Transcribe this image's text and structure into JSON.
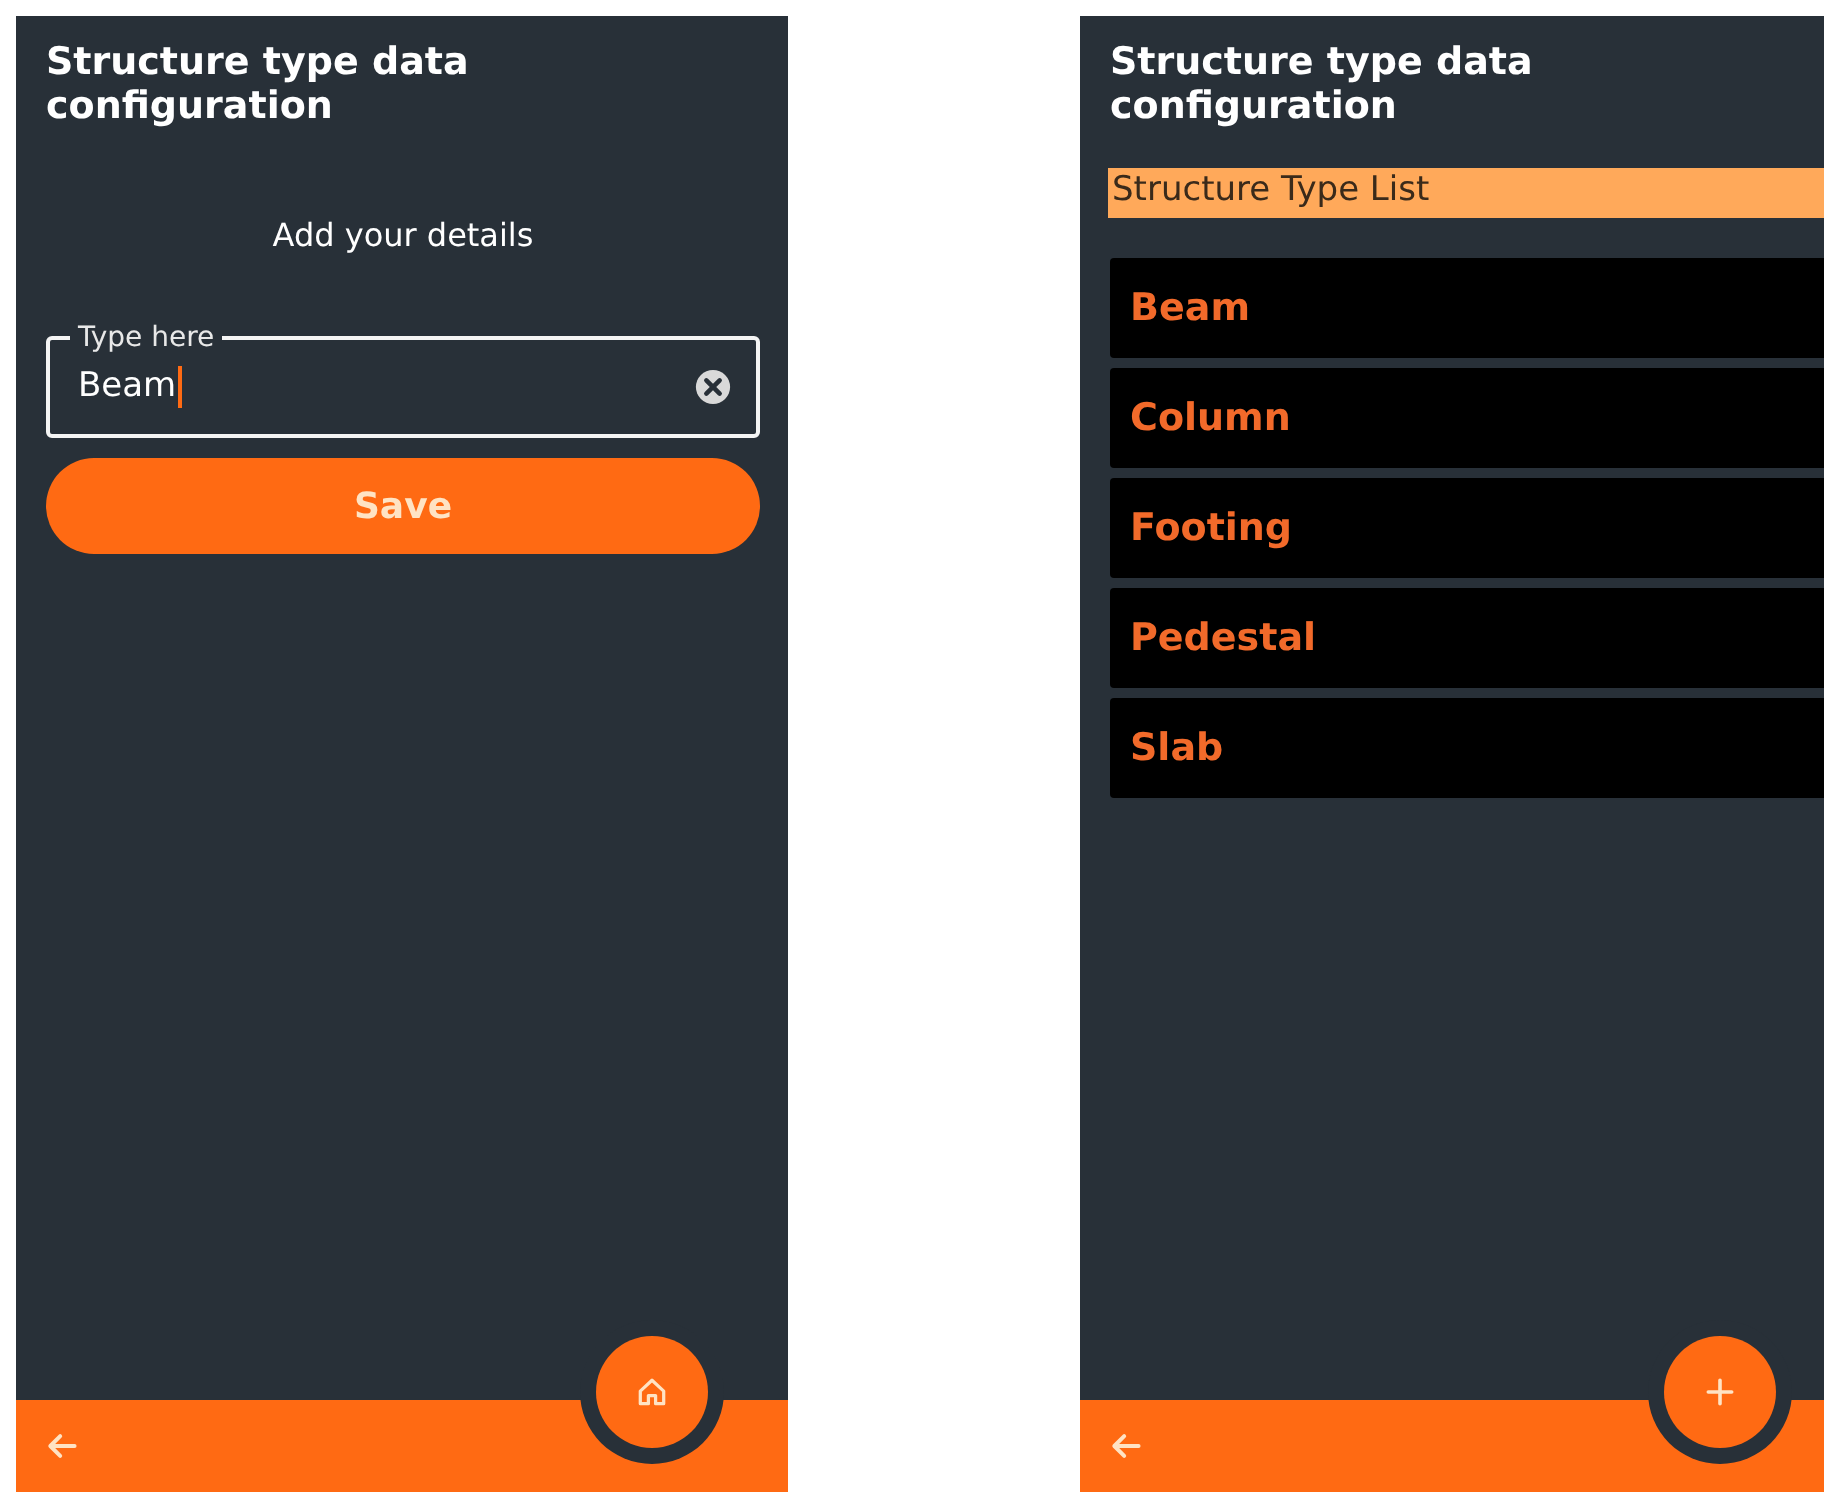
{
  "screens": [
    {
      "kind": "form",
      "title": "Structure type data configuration",
      "subtitle": "Add your details",
      "field": {
        "label": "Type here",
        "value": "Beam"
      },
      "save_button": "Save",
      "fab": {
        "kind": "home"
      }
    },
    {
      "kind": "list",
      "title": "Structure type data configuration",
      "list_header": "Structure Type List",
      "items": [
        "Beam",
        "Column",
        "Footing",
        "Pedestal",
        "Slab"
      ],
      "fab": {
        "kind": "add"
      }
    }
  ]
}
